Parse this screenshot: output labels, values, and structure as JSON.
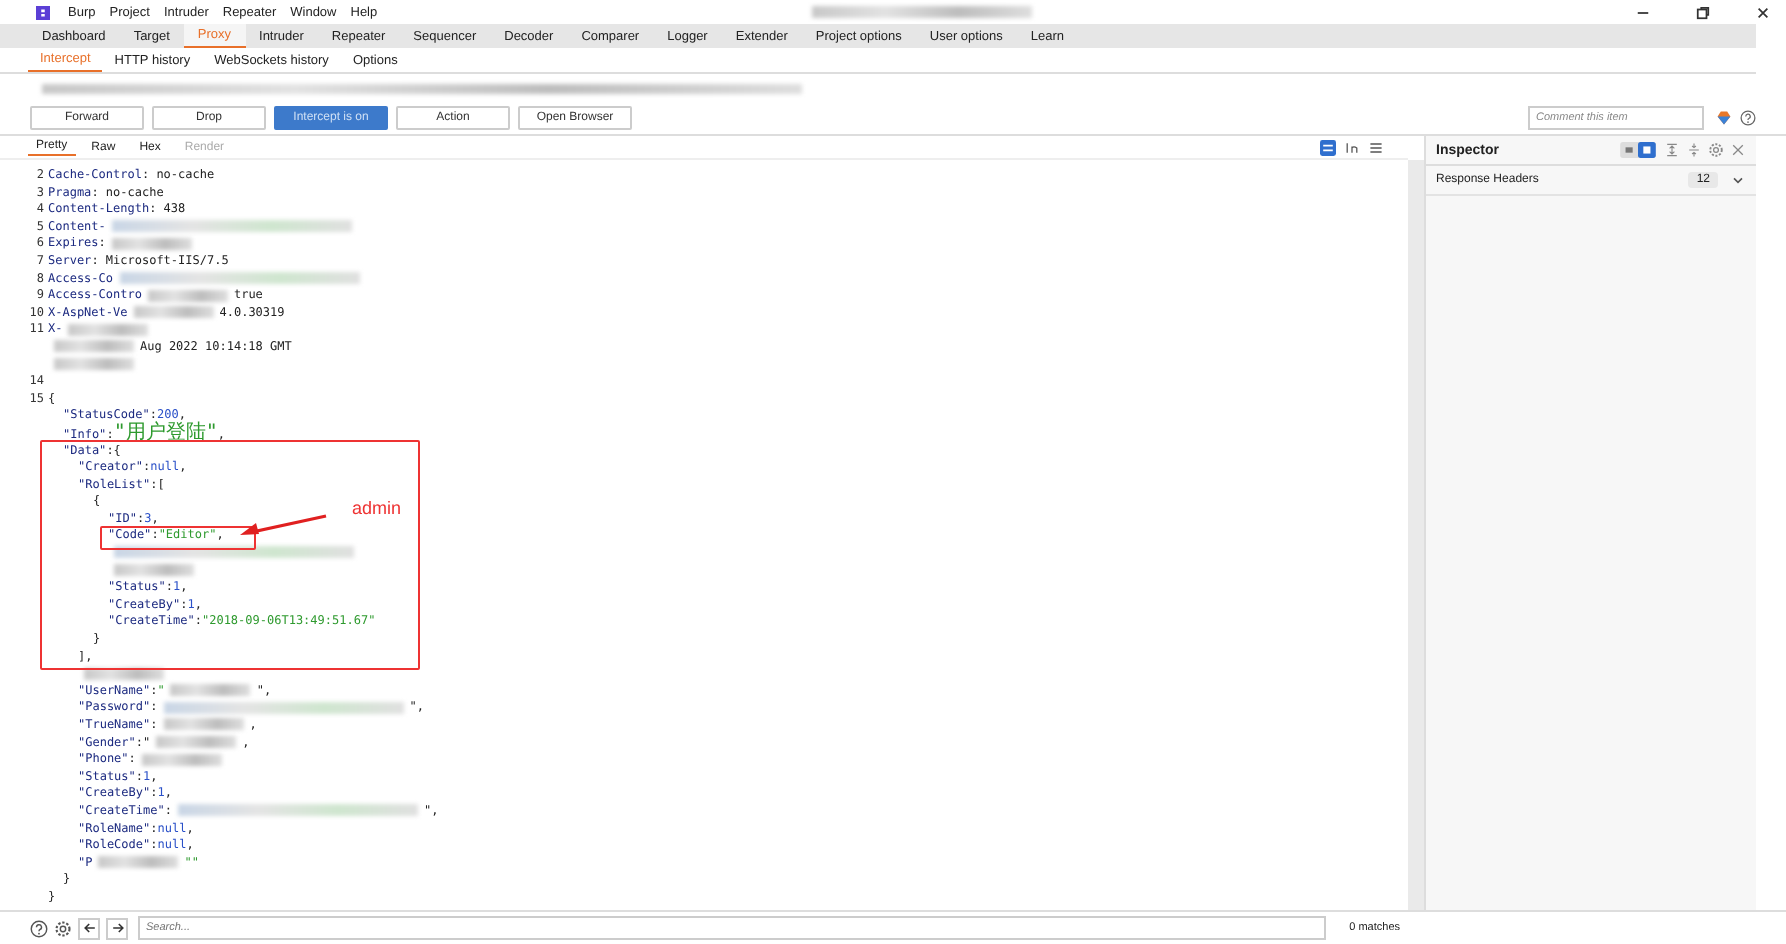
{
  "menu": [
    "Burp",
    "Project",
    "Intruder",
    "Repeater",
    "Window",
    "Help"
  ],
  "tabs": [
    {
      "label": "Dashboard",
      "selected": false
    },
    {
      "label": "Target",
      "selected": false
    },
    {
      "label": "Proxy",
      "selected": true
    },
    {
      "label": "Intruder",
      "selected": false
    },
    {
      "label": "Repeater",
      "selected": false
    },
    {
      "label": "Sequencer",
      "selected": false
    },
    {
      "label": "Decoder",
      "selected": false
    },
    {
      "label": "Comparer",
      "selected": false
    },
    {
      "label": "Logger",
      "selected": false
    },
    {
      "label": "Extender",
      "selected": false
    },
    {
      "label": "Project options",
      "selected": false
    },
    {
      "label": "User options",
      "selected": false
    },
    {
      "label": "Learn",
      "selected": false
    }
  ],
  "subtabs": [
    {
      "label": "Intercept",
      "selected": true
    },
    {
      "label": "HTTP history",
      "selected": false
    },
    {
      "label": "WebSockets history",
      "selected": false
    },
    {
      "label": "Options",
      "selected": false
    }
  ],
  "buttons": [
    {
      "label": "Forward",
      "kind": "plain"
    },
    {
      "label": "Drop",
      "kind": "plain"
    },
    {
      "label": "Intercept is on",
      "kind": "toggle"
    },
    {
      "label": "Action",
      "kind": "plain"
    },
    {
      "label": "Open Browser",
      "kind": "plain"
    }
  ],
  "comment": {
    "placeholder": "Comment this item"
  },
  "editor_tabs": [
    {
      "label": "Pretty",
      "selected": true,
      "disabled": false
    },
    {
      "label": "Raw",
      "selected": false,
      "disabled": false
    },
    {
      "label": "Hex",
      "selected": false,
      "disabled": false
    },
    {
      "label": "Render",
      "selected": false,
      "disabled": true
    }
  ],
  "lines": [
    {
      "num": "2",
      "tokens": [
        {
          "t": "Cache-Control",
          "kind": "hname"
        },
        {
          "t": ": no-cache",
          "kind": "p"
        }
      ]
    },
    {
      "num": "3",
      "tokens": [
        {
          "t": "Pragma",
          "kind": "hname"
        },
        {
          "t": ": no-cache",
          "kind": "p"
        }
      ]
    },
    {
      "num": "4",
      "tokens": [
        {
          "t": "Content-Length",
          "kind": "hname"
        },
        {
          "t": ": 438",
          "kind": "p"
        }
      ]
    },
    {
      "num": "5",
      "tokens": [
        {
          "t": "Content-",
          "kind": "hname"
        },
        {
          "kind": "blur_long"
        }
      ]
    },
    {
      "num": "6",
      "tokens": [
        {
          "t": "Expires",
          "kind": "hname"
        },
        {
          "t": ":",
          "kind": "p"
        },
        {
          "kind": "blur"
        }
      ]
    },
    {
      "num": "7",
      "tokens": [
        {
          "t": "Server",
          "kind": "hname"
        },
        {
          "t": ": Microsoft-IIS/7.5",
          "kind": "p"
        }
      ]
    },
    {
      "num": "8",
      "tokens": [
        {
          "t": "Access-Co",
          "kind": "hname"
        },
        {
          "kind": "blur_long"
        }
      ]
    },
    {
      "num": "9",
      "tokens": [
        {
          "t": "Access-Contro",
          "kind": "hname"
        },
        {
          "kind": "blur"
        },
        {
          "t": "true",
          "kind": "p"
        }
      ]
    },
    {
      "num": "10",
      "tokens": [
        {
          "t": "X-AspNet-Ve",
          "kind": "hname"
        },
        {
          "kind": "blur"
        },
        {
          "t": "4.0.30319",
          "kind": "p"
        }
      ]
    },
    {
      "num": "11",
      "tokens": [
        {
          "t": "X-",
          "kind": "hname"
        },
        {
          "kind": "blur"
        }
      ]
    },
    {
      "tokens": [
        {
          "kind": "blur"
        },
        {
          "t": "Aug 2022 10:14:18 GMT",
          "kind": "p"
        }
      ]
    },
    {
      "tokens": [
        {
          "kind": "blur"
        }
      ]
    },
    {
      "num": "14"
    },
    {
      "num": "15",
      "tokens": [
        {
          "t": "{",
          "kind": "p"
        }
      ],
      "children": [
        {
          "tokens": [
            {
              "t": "\"StatusCode\"",
              "kind": "key"
            },
            {
              "t": ":",
              "kind": "p"
            },
            {
              "t": "200",
              "kind": "num"
            },
            {
              "t": ",",
              "kind": "p"
            }
          ]
        },
        {
          "tokens": [
            {
              "t": "\"Info\"",
              "kind": "key"
            },
            {
              "t": ":",
              "kind": "p"
            },
            {
              "t": "\"用户登陆\"",
              "kind": "str"
            },
            {
              "t": ",",
              "kind": "p"
            }
          ]
        },
        {
          "tokens": [
            {
              "t": "\"Data\"",
              "kind": "key"
            },
            {
              "t": ":{",
              "kind": "p"
            }
          ],
          "frame_start": true,
          "children": [
            {
              "tokens": [
                {
                  "t": "\"Creator\"",
                  "kind": "key"
                },
                {
                  "t": ":",
                  "kind": "p"
                },
                {
                  "t": "null",
                  "kind": "num"
                },
                {
                  "t": ",",
                  "kind": "p"
                }
              ]
            },
            {
              "tokens": [
                {
                  "t": "\"RoleList\"",
                  "kind": "key"
                },
                {
                  "t": ":[",
                  "kind": "p"
                }
              ],
              "children": [
                {
                  "tokens": [
                    {
                      "t": "{",
                      "kind": "p"
                    }
                  ],
                  "children": [
                    {
                      "tokens": [
                        {
                          "t": "\"ID\"",
                          "kind": "key"
                        },
                        {
                          "t": ":",
                          "kind": "p"
                        },
                        {
                          "t": "3",
                          "kind": "num"
                        },
                        {
                          "t": ",",
                          "kind": "p"
                        }
                      ]
                    },
                    {
                      "tokens": [
                        {
                          "t": "\"Code\"",
                          "kind": "key"
                        },
                        {
                          "t": ":",
                          "kind": "p"
                        },
                        {
                          "t": "\"Editor\"",
                          "kind": "str"
                        },
                        {
                          "t": ",",
                          "kind": "p"
                        }
                      ],
                      "callout": "admin"
                    },
                    {
                      "tokens": [
                        {
                          "kind": "blur_long"
                        }
                      ]
                    },
                    {
                      "tokens": [
                        {
                          "kind": "blur"
                        }
                      ]
                    },
                    {
                      "tokens": [
                        {
                          "t": "\"Status\"",
                          "kind": "key"
                        },
                        {
                          "t": ":",
                          "kind": "p"
                        },
                        {
                          "t": "1",
                          "kind": "num"
                        },
                        {
                          "t": ",",
                          "kind": "p"
                        }
                      ]
                    },
                    {
                      "tokens": [
                        {
                          "t": "\"CreateBy\"",
                          "kind": "key"
                        },
                        {
                          "t": ":",
                          "kind": "p"
                        },
                        {
                          "t": "1",
                          "kind": "num"
                        },
                        {
                          "t": ",",
                          "kind": "p"
                        }
                      ]
                    },
                    {
                      "tokens": [
                        {
                          "t": "\"CreateTime\"",
                          "kind": "key"
                        },
                        {
                          "t": ":",
                          "kind": "p"
                        },
                        {
                          "t": "\"2018-09-06T13:49:51.67\"",
                          "kind": "str"
                        }
                      ]
                    }
                  ]
                },
                {
                  "tokens": [
                    {
                      "t": "}",
                      "kind": "p"
                    }
                  ]
                }
              ]
            },
            {
              "tokens": [
                {
                  "t": "],",
                  "kind": "p"
                }
              ],
              "frame_end": true
            },
            {
              "tokens": [
                {
                  "kind": "blur"
                }
              ]
            },
            {
              "tokens": [
                {
                  "t": "\"UserName\"",
                  "kind": "key"
                },
                {
                  "t": ":",
                  "kind": "p"
                },
                {
                  "t": "\"",
                  "kind": "str"
                },
                {
                  "kind": "blur"
                },
                {
                  "t": "\",",
                  "kind": "p"
                }
              ]
            },
            {
              "tokens": [
                {
                  "t": "\"Password\"",
                  "kind": "key"
                },
                {
                  "t": ":",
                  "kind": "p"
                },
                {
                  "kind": "blur_long"
                },
                {
                  "t": "\",",
                  "kind": "p"
                }
              ]
            },
            {
              "tokens": [
                {
                  "t": "\"TrueName\"",
                  "kind": "key"
                },
                {
                  "t": ":",
                  "kind": "p"
                },
                {
                  "kind": "blur"
                },
                {
                  "t": ",",
                  "kind": "p"
                }
              ]
            },
            {
              "tokens": [
                {
                  "t": "\"Gender\"",
                  "kind": "key"
                },
                {
                  "t": ":\"",
                  "kind": "p"
                },
                {
                  "kind": "blur"
                },
                {
                  "t": ",",
                  "kind": "p"
                }
              ]
            },
            {
              "tokens": [
                {
                  "t": "\"Phone\"",
                  "kind": "key"
                },
                {
                  "t": ":",
                  "kind": "p"
                },
                {
                  "kind": "blur"
                }
              ]
            },
            {
              "tokens": [
                {
                  "t": "\"Status\"",
                  "kind": "key"
                },
                {
                  "t": ":",
                  "kind": "p"
                },
                {
                  "t": "1",
                  "kind": "num"
                },
                {
                  "t": ",",
                  "kind": "p"
                }
              ]
            },
            {
              "tokens": [
                {
                  "t": "\"CreateBy\"",
                  "kind": "key"
                },
                {
                  "t": ":",
                  "kind": "p"
                },
                {
                  "t": "1",
                  "kind": "num"
                },
                {
                  "t": ",",
                  "kind": "p"
                }
              ]
            },
            {
              "tokens": [
                {
                  "t": "\"CreateTime\"",
                  "kind": "key"
                },
                {
                  "t": ":",
                  "kind": "p"
                },
                {
                  "kind": "blur_long"
                },
                {
                  "t": "\",",
                  "kind": "p"
                }
              ]
            },
            {
              "tokens": [
                {
                  "t": "\"RoleName\"",
                  "kind": "key"
                },
                {
                  "t": ":",
                  "kind": "p"
                },
                {
                  "t": "null",
                  "kind": "num"
                },
                {
                  "t": ",",
                  "kind": "p"
                }
              ]
            },
            {
              "tokens": [
                {
                  "t": "\"RoleCode\"",
                  "kind": "key"
                },
                {
                  "t": ":",
                  "kind": "p"
                },
                {
                  "t": "null",
                  "kind": "num"
                },
                {
                  "t": ",",
                  "kind": "p"
                }
              ]
            },
            {
              "tokens": [
                {
                  "t": "\"P",
                  "kind": "key"
                },
                {
                  "kind": "blur"
                },
                {
                  "t": "\"\"",
                  "kind": "str"
                }
              ]
            }
          ]
        },
        {
          "tokens": [
            {
              "t": "}",
              "kind": "p"
            }
          ]
        }
      ]
    },
    {
      "tokens": [
        {
          "t": "}",
          "kind": "p"
        }
      ]
    }
  ],
  "inspector": {
    "title": "Inspector",
    "sections": [
      {
        "label": "Response Headers",
        "count": "12",
        "expanded": false
      }
    ]
  },
  "search": {
    "placeholder": "Search..."
  },
  "matches": "0 matches"
}
